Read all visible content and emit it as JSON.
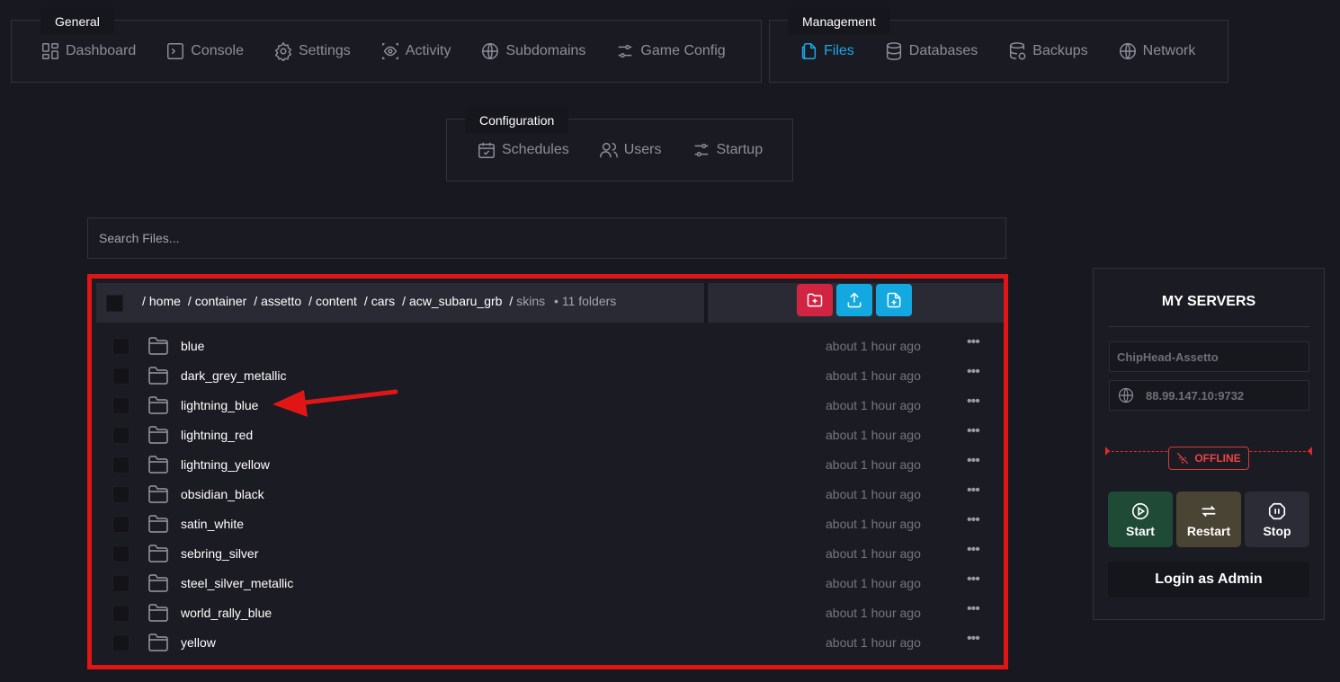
{
  "nav": {
    "general": {
      "label": "General",
      "items": [
        {
          "label": "Dashboard",
          "icon": "dashboard-icon"
        },
        {
          "label": "Console",
          "icon": "console-icon"
        },
        {
          "label": "Settings",
          "icon": "gear-icon"
        },
        {
          "label": "Activity",
          "icon": "eye-icon"
        },
        {
          "label": "Subdomains",
          "icon": "globe-icon"
        },
        {
          "label": "Game Config",
          "icon": "sliders-icon"
        }
      ]
    },
    "management": {
      "label": "Management",
      "items": [
        {
          "label": "Files",
          "icon": "files-icon",
          "active": true
        },
        {
          "label": "Databases",
          "icon": "database-icon"
        },
        {
          "label": "Backups",
          "icon": "backup-icon"
        },
        {
          "label": "Network",
          "icon": "globe-icon"
        }
      ]
    },
    "configuration": {
      "label": "Configuration",
      "items": [
        {
          "label": "Schedules",
          "icon": "calendar-icon"
        },
        {
          "label": "Users",
          "icon": "users-icon"
        },
        {
          "label": "Startup",
          "icon": "sliders-icon"
        }
      ]
    }
  },
  "search": {
    "placeholder": "Search Files..."
  },
  "files": {
    "breadcrumb": [
      "home",
      "container",
      "assetto",
      "content",
      "cars",
      "acw_subaru_grb"
    ],
    "current": "skins",
    "count": "• 11 folders",
    "items": [
      {
        "name": "blue",
        "modified": "about 1 hour ago"
      },
      {
        "name": "dark_grey_metallic",
        "modified": "about 1 hour ago"
      },
      {
        "name": "lightning_blue",
        "modified": "about 1 hour ago"
      },
      {
        "name": "lightning_red",
        "modified": "about 1 hour ago"
      },
      {
        "name": "lightning_yellow",
        "modified": "about 1 hour ago"
      },
      {
        "name": "obsidian_black",
        "modified": "about 1 hour ago"
      },
      {
        "name": "satin_white",
        "modified": "about 1 hour ago"
      },
      {
        "name": "sebring_silver",
        "modified": "about 1 hour ago"
      },
      {
        "name": "steel_silver_metallic",
        "modified": "about 1 hour ago"
      },
      {
        "name": "world_rally_blue",
        "modified": "about 1 hour ago"
      },
      {
        "name": "yellow",
        "modified": "about 1 hour ago"
      }
    ],
    "menu_glyph": "•••"
  },
  "server": {
    "title": "MY SERVERS",
    "name": "ChipHead-Assetto",
    "address": "88.99.147.10:9732",
    "status": "OFFLINE",
    "buttons": {
      "start": "Start",
      "restart": "Restart",
      "stop": "Stop"
    },
    "admin_label": "Login as Admin"
  },
  "colors": {
    "accent": "#1ba8e6",
    "highlight_border": "#e01616",
    "offline": "#ef4444",
    "new_folder_button": "#d12442"
  }
}
